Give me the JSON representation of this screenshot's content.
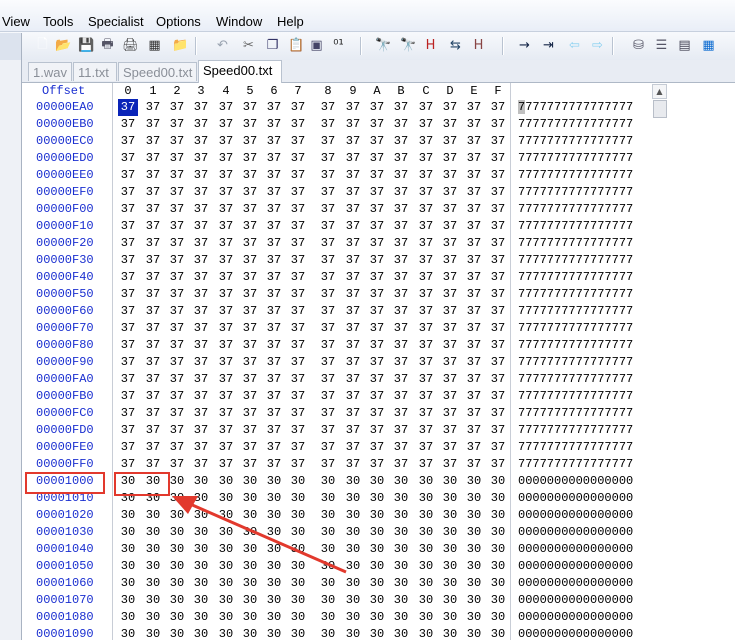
{
  "menu": [
    "View",
    "Tools",
    "Specialist",
    "Options",
    "Window",
    "Help"
  ],
  "toolbar_icons": [
    "new-file-icon",
    "open-folder-icon",
    "save-icon",
    "print-preview-icon",
    "print-icon",
    "properties-icon",
    "open-recent-icon",
    "undo-icon",
    "cut-icon",
    "copy-icon",
    "paste-icon",
    "paste-special-icon",
    "binary-icon",
    "find-icon",
    "replace-icon",
    "find-hex-icon",
    "replace-hex-icon",
    "find-next-hex-icon",
    "goto-icon",
    "goto-offset-icon",
    "back-icon",
    "forward-icon",
    "disk-tools-icon",
    "ram-editor-icon",
    "hash-icon",
    "calculator-icon"
  ],
  "tabs": [
    "1.wav",
    "11.txt",
    "Speed00.txt",
    "Speed00.txt"
  ],
  "active_tab": 3,
  "hex": {
    "offset_header": "Offset",
    "columns": [
      "0",
      "1",
      "2",
      "3",
      "4",
      "5",
      "6",
      "7",
      "8",
      "9",
      "A",
      "B",
      "C",
      "D",
      "E",
      "F"
    ],
    "rows": [
      {
        "offset": "00000EA0",
        "bytes": [
          "37",
          "37",
          "37",
          "37",
          "37",
          "37",
          "37",
          "37",
          "37",
          "37",
          "37",
          "37",
          "37",
          "37",
          "37",
          "37"
        ],
        "ascii": "7777777777777777"
      },
      {
        "offset": "00000EB0",
        "bytes": [
          "37",
          "37",
          "37",
          "37",
          "37",
          "37",
          "37",
          "37",
          "37",
          "37",
          "37",
          "37",
          "37",
          "37",
          "37",
          "37"
        ],
        "ascii": "7777777777777777"
      },
      {
        "offset": "00000EC0",
        "bytes": [
          "37",
          "37",
          "37",
          "37",
          "37",
          "37",
          "37",
          "37",
          "37",
          "37",
          "37",
          "37",
          "37",
          "37",
          "37",
          "37"
        ],
        "ascii": "7777777777777777"
      },
      {
        "offset": "00000ED0",
        "bytes": [
          "37",
          "37",
          "37",
          "37",
          "37",
          "37",
          "37",
          "37",
          "37",
          "37",
          "37",
          "37",
          "37",
          "37",
          "37",
          "37"
        ],
        "ascii": "7777777777777777"
      },
      {
        "offset": "00000EE0",
        "bytes": [
          "37",
          "37",
          "37",
          "37",
          "37",
          "37",
          "37",
          "37",
          "37",
          "37",
          "37",
          "37",
          "37",
          "37",
          "37",
          "37"
        ],
        "ascii": "7777777777777777"
      },
      {
        "offset": "00000EF0",
        "bytes": [
          "37",
          "37",
          "37",
          "37",
          "37",
          "37",
          "37",
          "37",
          "37",
          "37",
          "37",
          "37",
          "37",
          "37",
          "37",
          "37"
        ],
        "ascii": "7777777777777777"
      },
      {
        "offset": "00000F00",
        "bytes": [
          "37",
          "37",
          "37",
          "37",
          "37",
          "37",
          "37",
          "37",
          "37",
          "37",
          "37",
          "37",
          "37",
          "37",
          "37",
          "37"
        ],
        "ascii": "7777777777777777"
      },
      {
        "offset": "00000F10",
        "bytes": [
          "37",
          "37",
          "37",
          "37",
          "37",
          "37",
          "37",
          "37",
          "37",
          "37",
          "37",
          "37",
          "37",
          "37",
          "37",
          "37"
        ],
        "ascii": "7777777777777777"
      },
      {
        "offset": "00000F20",
        "bytes": [
          "37",
          "37",
          "37",
          "37",
          "37",
          "37",
          "37",
          "37",
          "37",
          "37",
          "37",
          "37",
          "37",
          "37",
          "37",
          "37"
        ],
        "ascii": "7777777777777777"
      },
      {
        "offset": "00000F30",
        "bytes": [
          "37",
          "37",
          "37",
          "37",
          "37",
          "37",
          "37",
          "37",
          "37",
          "37",
          "37",
          "37",
          "37",
          "37",
          "37",
          "37"
        ],
        "ascii": "7777777777777777"
      },
      {
        "offset": "00000F40",
        "bytes": [
          "37",
          "37",
          "37",
          "37",
          "37",
          "37",
          "37",
          "37",
          "37",
          "37",
          "37",
          "37",
          "37",
          "37",
          "37",
          "37"
        ],
        "ascii": "7777777777777777"
      },
      {
        "offset": "00000F50",
        "bytes": [
          "37",
          "37",
          "37",
          "37",
          "37",
          "37",
          "37",
          "37",
          "37",
          "37",
          "37",
          "37",
          "37",
          "37",
          "37",
          "37"
        ],
        "ascii": "7777777777777777"
      },
      {
        "offset": "00000F60",
        "bytes": [
          "37",
          "37",
          "37",
          "37",
          "37",
          "37",
          "37",
          "37",
          "37",
          "37",
          "37",
          "37",
          "37",
          "37",
          "37",
          "37"
        ],
        "ascii": "7777777777777777"
      },
      {
        "offset": "00000F70",
        "bytes": [
          "37",
          "37",
          "37",
          "37",
          "37",
          "37",
          "37",
          "37",
          "37",
          "37",
          "37",
          "37",
          "37",
          "37",
          "37",
          "37"
        ],
        "ascii": "7777777777777777"
      },
      {
        "offset": "00000F80",
        "bytes": [
          "37",
          "37",
          "37",
          "37",
          "37",
          "37",
          "37",
          "37",
          "37",
          "37",
          "37",
          "37",
          "37",
          "37",
          "37",
          "37"
        ],
        "ascii": "7777777777777777"
      },
      {
        "offset": "00000F90",
        "bytes": [
          "37",
          "37",
          "37",
          "37",
          "37",
          "37",
          "37",
          "37",
          "37",
          "37",
          "37",
          "37",
          "37",
          "37",
          "37",
          "37"
        ],
        "ascii": "7777777777777777"
      },
      {
        "offset": "00000FA0",
        "bytes": [
          "37",
          "37",
          "37",
          "37",
          "37",
          "37",
          "37",
          "37",
          "37",
          "37",
          "37",
          "37",
          "37",
          "37",
          "37",
          "37"
        ],
        "ascii": "7777777777777777"
      },
      {
        "offset": "00000FB0",
        "bytes": [
          "37",
          "37",
          "37",
          "37",
          "37",
          "37",
          "37",
          "37",
          "37",
          "37",
          "37",
          "37",
          "37",
          "37",
          "37",
          "37"
        ],
        "ascii": "7777777777777777"
      },
      {
        "offset": "00000FC0",
        "bytes": [
          "37",
          "37",
          "37",
          "37",
          "37",
          "37",
          "37",
          "37",
          "37",
          "37",
          "37",
          "37",
          "37",
          "37",
          "37",
          "37"
        ],
        "ascii": "7777777777777777"
      },
      {
        "offset": "00000FD0",
        "bytes": [
          "37",
          "37",
          "37",
          "37",
          "37",
          "37",
          "37",
          "37",
          "37",
          "37",
          "37",
          "37",
          "37",
          "37",
          "37",
          "37"
        ],
        "ascii": "7777777777777777"
      },
      {
        "offset": "00000FE0",
        "bytes": [
          "37",
          "37",
          "37",
          "37",
          "37",
          "37",
          "37",
          "37",
          "37",
          "37",
          "37",
          "37",
          "37",
          "37",
          "37",
          "37"
        ],
        "ascii": "7777777777777777"
      },
      {
        "offset": "00000FF0",
        "bytes": [
          "37",
          "37",
          "37",
          "37",
          "37",
          "37",
          "37",
          "37",
          "37",
          "37",
          "37",
          "37",
          "37",
          "37",
          "37",
          "37"
        ],
        "ascii": "7777777777777777"
      },
      {
        "offset": "00001000",
        "bytes": [
          "30",
          "30",
          "30",
          "30",
          "30",
          "30",
          "30",
          "30",
          "30",
          "30",
          "30",
          "30",
          "30",
          "30",
          "30",
          "30"
        ],
        "ascii": "0000000000000000"
      },
      {
        "offset": "00001010",
        "bytes": [
          "30",
          "30",
          "30",
          "30",
          "30",
          "30",
          "30",
          "30",
          "30",
          "30",
          "30",
          "30",
          "30",
          "30",
          "30",
          "30"
        ],
        "ascii": "0000000000000000"
      },
      {
        "offset": "00001020",
        "bytes": [
          "30",
          "30",
          "30",
          "30",
          "30",
          "30",
          "30",
          "30",
          "30",
          "30",
          "30",
          "30",
          "30",
          "30",
          "30",
          "30"
        ],
        "ascii": "0000000000000000"
      },
      {
        "offset": "00001030",
        "bytes": [
          "30",
          "30",
          "30",
          "30",
          "30",
          "30",
          "30",
          "30",
          "30",
          "30",
          "30",
          "30",
          "30",
          "30",
          "30",
          "30"
        ],
        "ascii": "0000000000000000"
      },
      {
        "offset": "00001040",
        "bytes": [
          "30",
          "30",
          "30",
          "30",
          "30",
          "30",
          "30",
          "30",
          "30",
          "30",
          "30",
          "30",
          "30",
          "30",
          "30",
          "30"
        ],
        "ascii": "0000000000000000"
      },
      {
        "offset": "00001050",
        "bytes": [
          "30",
          "30",
          "30",
          "30",
          "30",
          "30",
          "30",
          "30",
          "30",
          "30",
          "30",
          "30",
          "30",
          "30",
          "30",
          "30"
        ],
        "ascii": "0000000000000000"
      },
      {
        "offset": "00001060",
        "bytes": [
          "30",
          "30",
          "30",
          "30",
          "30",
          "30",
          "30",
          "30",
          "30",
          "30",
          "30",
          "30",
          "30",
          "30",
          "30",
          "30"
        ],
        "ascii": "0000000000000000"
      },
      {
        "offset": "00001070",
        "bytes": [
          "30",
          "30",
          "30",
          "30",
          "30",
          "30",
          "30",
          "30",
          "30",
          "30",
          "30",
          "30",
          "30",
          "30",
          "30",
          "30"
        ],
        "ascii": "0000000000000000"
      },
      {
        "offset": "00001080",
        "bytes": [
          "30",
          "30",
          "30",
          "30",
          "30",
          "30",
          "30",
          "30",
          "30",
          "30",
          "30",
          "30",
          "30",
          "30",
          "30",
          "30"
        ],
        "ascii": "0000000000000000"
      },
      {
        "offset": "00001090",
        "bytes": [
          "30",
          "30",
          "30",
          "30",
          "30",
          "30",
          "30",
          "30",
          "30",
          "30",
          "30",
          "30",
          "30",
          "30",
          "30",
          "30"
        ],
        "ascii": "0000000000000000"
      }
    ]
  },
  "colors": {
    "offset_text": "#1a2fd0",
    "cursor_bg": "#0a24b8",
    "annotation_red": "#e2392d"
  }
}
